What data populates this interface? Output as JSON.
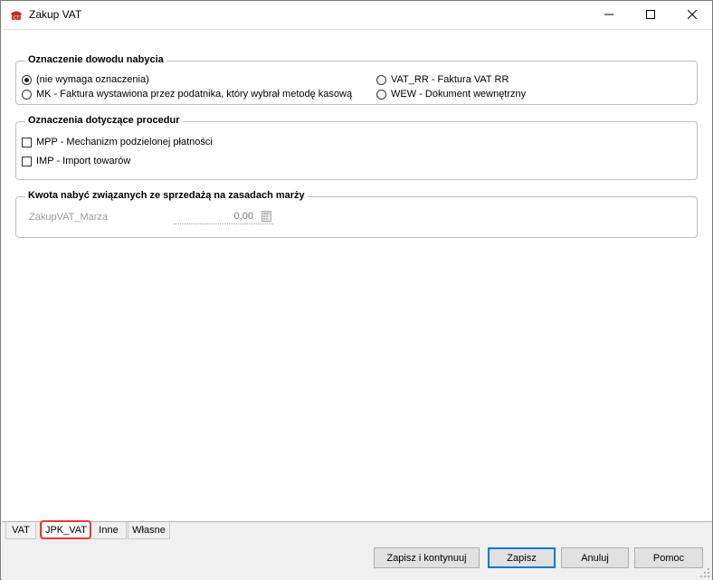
{
  "window": {
    "title": "Zakup VAT",
    "icon": "app-icon"
  },
  "group1": {
    "title": "Oznaczenie dowodu nabycia",
    "options": [
      {
        "label": "(nie wymaga oznaczenia)",
        "checked": true
      },
      {
        "label": "MK - Faktura wystawiona przez podatnika, który wybrał metodę kasową",
        "checked": false
      },
      {
        "label": "VAT_RR - Faktura VAT RR",
        "checked": false
      },
      {
        "label": "WEW - Dokument wewnętrzny",
        "checked": false
      }
    ]
  },
  "group2": {
    "title": "Oznaczenia dotyczące procedur",
    "checkboxes": [
      {
        "label": "MPP - Mechanizm podzielonej płatności",
        "checked": false
      },
      {
        "label": "IMP - Import towarów",
        "checked": false
      }
    ]
  },
  "group3": {
    "title": "Kwota nabyć związanych ze sprzedażą na zasadach marży",
    "field_label": "ZakupVAT_Marza",
    "field_value": "0,00"
  },
  "tabs": {
    "items": [
      "VAT",
      "JPK_VAT",
      "Inne",
      "Własne"
    ],
    "active": "JPK_VAT",
    "highlight_color": "#e53935"
  },
  "buttons": {
    "save_continue": "Zapisz i kontynuuj",
    "save": "Zapisz",
    "cancel": "Anuluj",
    "help": "Pomoc"
  },
  "colors": {
    "default_button_border": "#0078d7"
  }
}
